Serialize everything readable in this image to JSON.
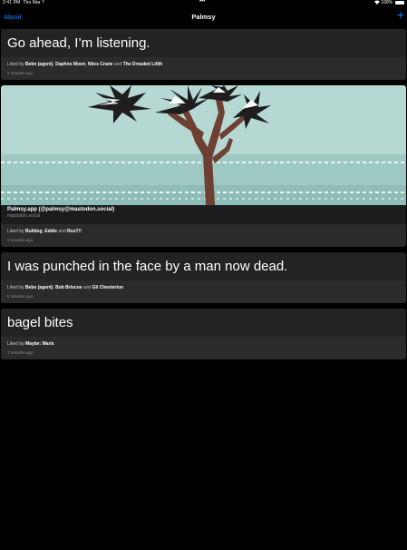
{
  "status_bar": {
    "time": "2:41 PM",
    "date": "Thu Mar 7",
    "dots": "•••",
    "battery_text": "100%",
    "battery_level": 1.0
  },
  "nav": {
    "about_label": "About",
    "title": "Palmsy",
    "add_label": "+"
  },
  "posts": [
    {
      "text": "Go ahead, I’m listening.",
      "liked_prefix": "Liked by ",
      "likers": [
        "Bebe (agent)",
        "Daphne Moon",
        "Niles Crane",
        "The Dreaded Lilith"
      ],
      "separators": [
        ", ",
        ", ",
        " and "
      ],
      "time": "2 minutes ago"
    },
    {
      "author": "Palmsy.app (@palmsy@mastodon.social)",
      "server": "mastodon.social",
      "liked_prefix": "Liked by ",
      "likers": [
        "Bulldog",
        "Eddie",
        "Roz!!!!"
      ],
      "separators": [
        ", ",
        " and "
      ],
      "time": "3 minutes ago"
    },
    {
      "text": "I was punched in the face by a man now dead.",
      "liked_prefix": "Liked by ",
      "likers": [
        "Bebe (agent)",
        "Bob Briscoe",
        "Gil Chesterton"
      ],
      "separators": [
        ", ",
        " and "
      ],
      "time": "5 minutes ago"
    },
    {
      "text": "bagel bites",
      "liked_prefix": "Liked by ",
      "likers": [
        "Maybe: Maris"
      ],
      "separators": [],
      "time": "7 minutes ago"
    }
  ],
  "colors": {
    "accent": "#0a84ff",
    "card": "#232325",
    "meta": "#2b2b2d",
    "sky": "#a8d2cc",
    "trunk": "#6e3f32"
  }
}
